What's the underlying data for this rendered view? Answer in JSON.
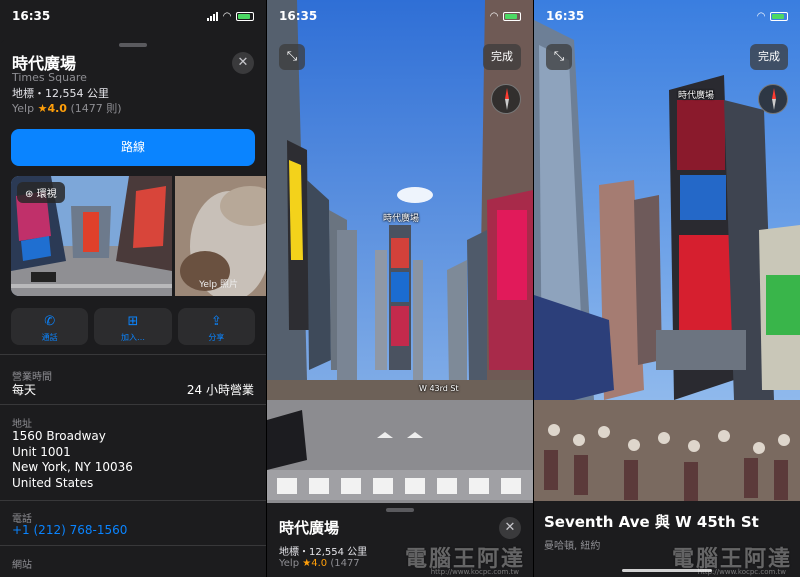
{
  "status_bars": [
    {
      "time": "16:35"
    },
    {
      "time": "16:35"
    },
    {
      "time": "16:35"
    }
  ],
  "place_card": {
    "title": "時代廣場",
    "subtitle": "Times Square",
    "meta": "地標・12,554 公里",
    "rating_source": "Yelp",
    "rating": "★4.0",
    "rating_count": "(1477 則)",
    "close_icon": "close-icon",
    "route_label": "路線",
    "lookaround_label": "環視",
    "yelp_photos_label": "Yelp 照片",
    "actions": [
      {
        "icon": "phone-icon",
        "label": "通話"
      },
      {
        "icon": "plus-icon",
        "label": "加入…"
      },
      {
        "icon": "share-icon",
        "label": "分享"
      }
    ],
    "hours_label": "營業時間",
    "hours_day": "每天",
    "hours_value": "24 小時營業",
    "address_label": "地址",
    "address_lines": [
      "1560 Broadway",
      "Unit 1001",
      "New York, NY  10036",
      "United States"
    ],
    "phone_label": "電話",
    "phone_value": "+1 (212) 768-1560",
    "website_label": "網站"
  },
  "lookaround_1": {
    "done_label": "完成",
    "collapse_icon": "collapse-icon",
    "poi_label": "時代廣場",
    "sheet_title": "時代廣場",
    "sheet_meta": "地標・12,554 公里",
    "sheet_rating_source": "Yelp",
    "sheet_rating": "★4.0",
    "sheet_rating_count": "(1477",
    "street_label": "W 43rd St"
  },
  "lookaround_2": {
    "done_label": "完成",
    "collapse_icon": "collapse-icon",
    "poi_label": "時代廣場",
    "sheet_title": "Seventh Ave 與 W 45th St",
    "sheet_sub": "曼哈頓, 紐約"
  },
  "watermark": {
    "text": "電腦王阿達",
    "url": "http://www.kocpc.com.tw"
  },
  "colors": {
    "accent": "#0a84ff",
    "star": "#ff9f0a",
    "sheet_bg": "#1c1c1e"
  }
}
